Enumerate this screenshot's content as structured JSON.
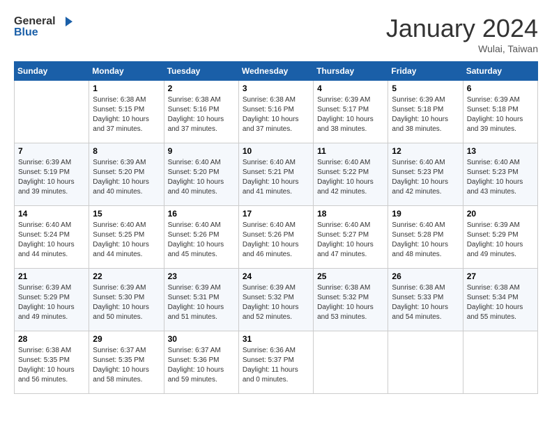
{
  "header": {
    "logo_line1": "General",
    "logo_line2": "Blue",
    "month": "January 2024",
    "location": "Wulai, Taiwan"
  },
  "days_of_week": [
    "Sunday",
    "Monday",
    "Tuesday",
    "Wednesday",
    "Thursday",
    "Friday",
    "Saturday"
  ],
  "weeks": [
    [
      {
        "num": "",
        "info": ""
      },
      {
        "num": "1",
        "info": "Sunrise: 6:38 AM\nSunset: 5:15 PM\nDaylight: 10 hours\nand 37 minutes."
      },
      {
        "num": "2",
        "info": "Sunrise: 6:38 AM\nSunset: 5:16 PM\nDaylight: 10 hours\nand 37 minutes."
      },
      {
        "num": "3",
        "info": "Sunrise: 6:38 AM\nSunset: 5:16 PM\nDaylight: 10 hours\nand 37 minutes."
      },
      {
        "num": "4",
        "info": "Sunrise: 6:39 AM\nSunset: 5:17 PM\nDaylight: 10 hours\nand 38 minutes."
      },
      {
        "num": "5",
        "info": "Sunrise: 6:39 AM\nSunset: 5:18 PM\nDaylight: 10 hours\nand 38 minutes."
      },
      {
        "num": "6",
        "info": "Sunrise: 6:39 AM\nSunset: 5:18 PM\nDaylight: 10 hours\nand 39 minutes."
      }
    ],
    [
      {
        "num": "7",
        "info": "Sunrise: 6:39 AM\nSunset: 5:19 PM\nDaylight: 10 hours\nand 39 minutes."
      },
      {
        "num": "8",
        "info": "Sunrise: 6:39 AM\nSunset: 5:20 PM\nDaylight: 10 hours\nand 40 minutes."
      },
      {
        "num": "9",
        "info": "Sunrise: 6:40 AM\nSunset: 5:20 PM\nDaylight: 10 hours\nand 40 minutes."
      },
      {
        "num": "10",
        "info": "Sunrise: 6:40 AM\nSunset: 5:21 PM\nDaylight: 10 hours\nand 41 minutes."
      },
      {
        "num": "11",
        "info": "Sunrise: 6:40 AM\nSunset: 5:22 PM\nDaylight: 10 hours\nand 42 minutes."
      },
      {
        "num": "12",
        "info": "Sunrise: 6:40 AM\nSunset: 5:23 PM\nDaylight: 10 hours\nand 42 minutes."
      },
      {
        "num": "13",
        "info": "Sunrise: 6:40 AM\nSunset: 5:23 PM\nDaylight: 10 hours\nand 43 minutes."
      }
    ],
    [
      {
        "num": "14",
        "info": "Sunrise: 6:40 AM\nSunset: 5:24 PM\nDaylight: 10 hours\nand 44 minutes."
      },
      {
        "num": "15",
        "info": "Sunrise: 6:40 AM\nSunset: 5:25 PM\nDaylight: 10 hours\nand 44 minutes."
      },
      {
        "num": "16",
        "info": "Sunrise: 6:40 AM\nSunset: 5:26 PM\nDaylight: 10 hours\nand 45 minutes."
      },
      {
        "num": "17",
        "info": "Sunrise: 6:40 AM\nSunset: 5:26 PM\nDaylight: 10 hours\nand 46 minutes."
      },
      {
        "num": "18",
        "info": "Sunrise: 6:40 AM\nSunset: 5:27 PM\nDaylight: 10 hours\nand 47 minutes."
      },
      {
        "num": "19",
        "info": "Sunrise: 6:40 AM\nSunset: 5:28 PM\nDaylight: 10 hours\nand 48 minutes."
      },
      {
        "num": "20",
        "info": "Sunrise: 6:39 AM\nSunset: 5:29 PM\nDaylight: 10 hours\nand 49 minutes."
      }
    ],
    [
      {
        "num": "21",
        "info": "Sunrise: 6:39 AM\nSunset: 5:29 PM\nDaylight: 10 hours\nand 49 minutes."
      },
      {
        "num": "22",
        "info": "Sunrise: 6:39 AM\nSunset: 5:30 PM\nDaylight: 10 hours\nand 50 minutes."
      },
      {
        "num": "23",
        "info": "Sunrise: 6:39 AM\nSunset: 5:31 PM\nDaylight: 10 hours\nand 51 minutes."
      },
      {
        "num": "24",
        "info": "Sunrise: 6:39 AM\nSunset: 5:32 PM\nDaylight: 10 hours\nand 52 minutes."
      },
      {
        "num": "25",
        "info": "Sunrise: 6:38 AM\nSunset: 5:32 PM\nDaylight: 10 hours\nand 53 minutes."
      },
      {
        "num": "26",
        "info": "Sunrise: 6:38 AM\nSunset: 5:33 PM\nDaylight: 10 hours\nand 54 minutes."
      },
      {
        "num": "27",
        "info": "Sunrise: 6:38 AM\nSunset: 5:34 PM\nDaylight: 10 hours\nand 55 minutes."
      }
    ],
    [
      {
        "num": "28",
        "info": "Sunrise: 6:38 AM\nSunset: 5:35 PM\nDaylight: 10 hours\nand 56 minutes."
      },
      {
        "num": "29",
        "info": "Sunrise: 6:37 AM\nSunset: 5:35 PM\nDaylight: 10 hours\nand 58 minutes."
      },
      {
        "num": "30",
        "info": "Sunrise: 6:37 AM\nSunset: 5:36 PM\nDaylight: 10 hours\nand 59 minutes."
      },
      {
        "num": "31",
        "info": "Sunrise: 6:36 AM\nSunset: 5:37 PM\nDaylight: 11 hours\nand 0 minutes."
      },
      {
        "num": "",
        "info": ""
      },
      {
        "num": "",
        "info": ""
      },
      {
        "num": "",
        "info": ""
      }
    ]
  ]
}
